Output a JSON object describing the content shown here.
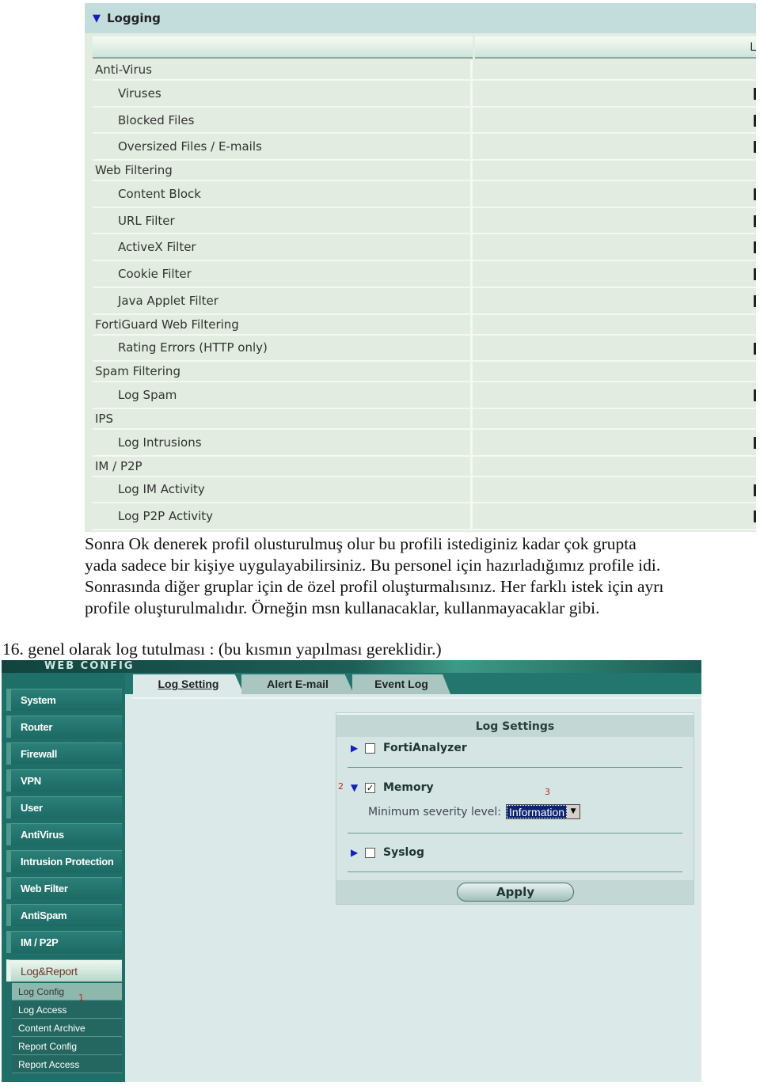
{
  "logging": {
    "title": "Logging",
    "column_header": "L",
    "rows": [
      {
        "label": "Anti-Virus",
        "type": "cat"
      },
      {
        "label": "Viruses",
        "type": "sub"
      },
      {
        "label": "Blocked Files",
        "type": "sub"
      },
      {
        "label": "Oversized Files / E-mails",
        "type": "sub"
      },
      {
        "label": "Web Filtering",
        "type": "cat"
      },
      {
        "label": "Content Block",
        "type": "sub"
      },
      {
        "label": "URL Filter",
        "type": "sub"
      },
      {
        "label": "ActiveX Filter",
        "type": "sub"
      },
      {
        "label": "Cookie Filter",
        "type": "sub"
      },
      {
        "label": "Java Applet Filter",
        "type": "sub"
      },
      {
        "label": "FortiGuard Web Filtering",
        "type": "cat"
      },
      {
        "label": "Rating Errors (HTTP only)",
        "type": "sub"
      },
      {
        "label": "Spam Filtering",
        "type": "cat"
      },
      {
        "label": "Log Spam",
        "type": "sub"
      },
      {
        "label": "IPS",
        "type": "cat"
      },
      {
        "label": "Log Intrusions",
        "type": "sub"
      },
      {
        "label": "IM / P2P",
        "type": "cat"
      },
      {
        "label": "Log IM Activity",
        "type": "sub"
      },
      {
        "label": "Log P2P Activity",
        "type": "sub"
      }
    ]
  },
  "document": {
    "paragraph": " Sonra Ok denerek profil olusturulmuş olur bu profili istediginiz kadar çok grupta yada sadece bir kişiye uygulayabilirsiniz. Bu personel için hazırladığımız profile idi. Sonrasında diğer gruplar için de özel profil oluşturmalısınız. Her farklı istek için ayrı profile oluşturulmalıdır. Örneğin msn kullanacaklar, kullanmayacaklar gibi.",
    "heading": "16. genel olarak log tutulması : (bu kısmın yapılması gereklidir.)"
  },
  "webconfig": {
    "banner": "WEB CONFIG",
    "sidebar": [
      "System",
      "Router",
      "Firewall",
      "VPN",
      "User",
      "AntiVirus",
      "Intrusion Protection",
      "Web Filter",
      "AntiSpam",
      "IM / P2P"
    ],
    "open_section": "Log&Report",
    "subitems": [
      "Log Config",
      "Log Access",
      "Content Archive",
      "Report Config",
      "Report Access"
    ],
    "selected_subitem": "Log Config",
    "tabs": [
      "Log Setting",
      "Alert E-mail",
      "Event Log"
    ],
    "active_tab": "Log Setting",
    "panel": {
      "title": "Log Settings",
      "options": [
        {
          "label": "FortiAnalyzer",
          "checked": false,
          "expanded": false
        },
        {
          "label": "Memory",
          "checked": true,
          "expanded": true
        },
        {
          "label": "Syslog",
          "checked": false,
          "expanded": false
        }
      ],
      "severity_label": "Minimum severity level:",
      "severity_value": "Information",
      "apply_label": "Apply"
    },
    "annotations": [
      "1",
      "2",
      "3"
    ]
  },
  "colors": {
    "sidebar": "#1f6f69",
    "content": "#dbe9e8",
    "arrow": "#1020c0",
    "annotation": "#d02020"
  }
}
